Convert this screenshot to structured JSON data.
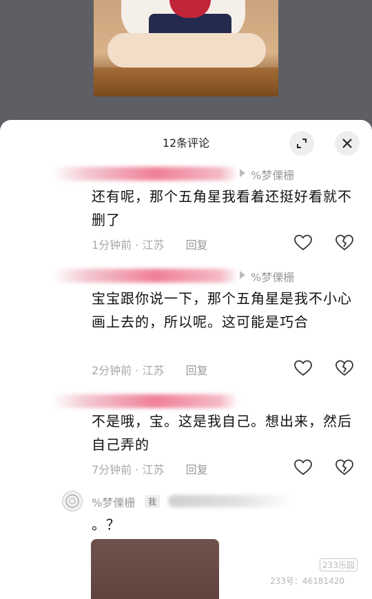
{
  "sheet": {
    "title": "12条评论"
  },
  "comments": [
    {
      "reply_to": "%梦傈栅",
      "text": "还有呢，那个五角星我看着还挺好看就不删了",
      "time": "1分钟前",
      "location": "江苏",
      "reply_label": "回复"
    },
    {
      "reply_to": "%梦傈栅",
      "text": "宝宝跟你说一下，那个五角星是我不小心画上去的，所以呢。这可能是巧合",
      "time": "2分钟前",
      "location": "江苏",
      "reply_label": "回复"
    },
    {
      "reply_to": "",
      "text": "不是哦，宝。这是我自己。想出来，然后自己弄的",
      "time": "7分钟前",
      "location": "江苏",
      "reply_label": "回复"
    }
  ],
  "last_comment": {
    "username": "%梦傈栅",
    "badge": "我",
    "text": "。？"
  },
  "watermark": {
    "logo": "233乐园",
    "id_text": "233号：46181420"
  },
  "colors": {
    "sheet_bg": "#ffffff",
    "backdrop": "#5b5c61",
    "meta_text": "#a8a8a8",
    "name_blur_pink": "#ef7f97"
  },
  "icons": {
    "expand": "expand-icon",
    "close": "close-icon",
    "like": "heart-outline-icon",
    "dislike": "broken-heart-icon"
  }
}
